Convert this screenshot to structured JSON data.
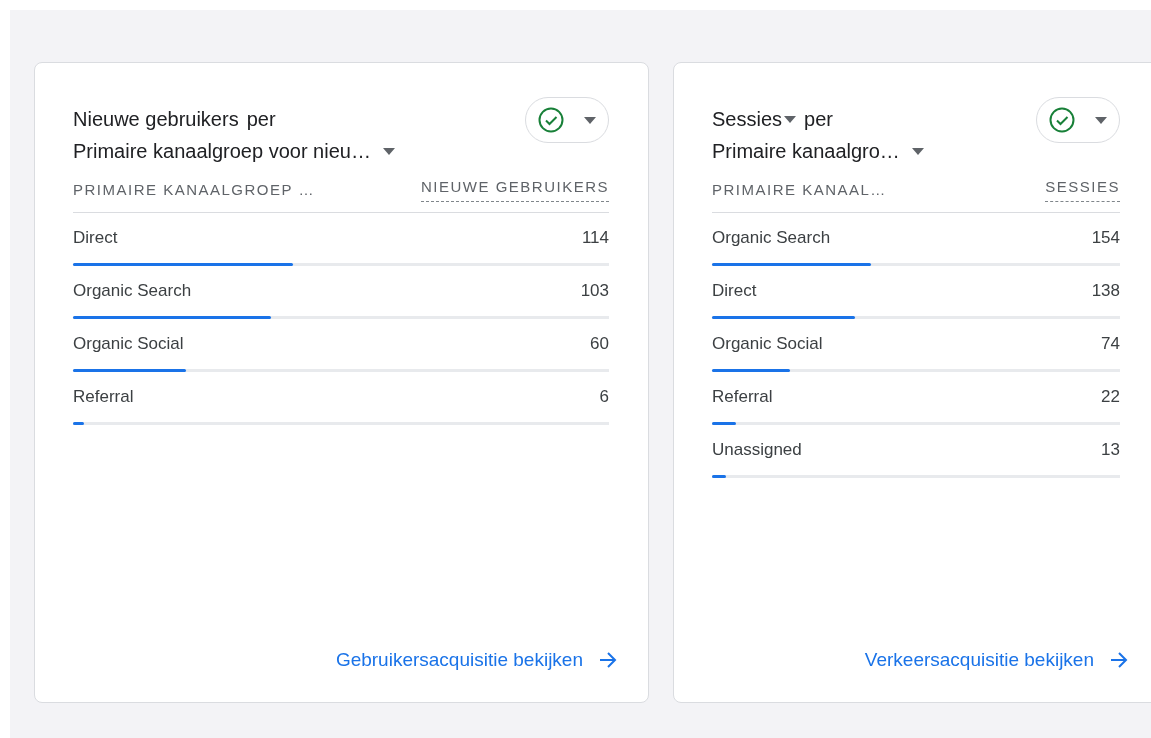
{
  "cards": [
    {
      "title_metric": "Nieuwe gebruikers",
      "metric_dropdown": false,
      "title_per": "per",
      "title_dimension": "Primaire kanaalgroep voor nieu…",
      "status_ok": true,
      "columns": [
        "PRIMAIRE KANAALGROEP …",
        "NIEUWE GEBRUIKERS"
      ],
      "rows": [
        {
          "label": "Direct",
          "value": "114",
          "level": 0.41
        },
        {
          "label": "Organic Search",
          "value": "103",
          "level": 0.37
        },
        {
          "label": "Organic Social",
          "value": "60",
          "level": 0.21
        },
        {
          "label": "Referral",
          "value": "6",
          "level": 0.02
        }
      ],
      "link": "Gebruikersacquisitie bekijken"
    },
    {
      "title_metric": "Sessies",
      "metric_dropdown": true,
      "title_per": "per",
      "title_dimension": "Primaire kanaalgro…",
      "status_ok": true,
      "columns": [
        "PRIMAIRE KANAAL…",
        "SESSIES"
      ],
      "rows": [
        {
          "label": "Organic Search",
          "value": "154",
          "level": 0.39
        },
        {
          "label": "Direct",
          "value": "138",
          "level": 0.35
        },
        {
          "label": "Organic Social",
          "value": "74",
          "level": 0.19
        },
        {
          "label": "Referral",
          "value": "22",
          "level": 0.06
        },
        {
          "label": "Unassigned",
          "value": "13",
          "level": 0.035
        }
      ],
      "link": "Verkeersacquisitie bekijken"
    }
  ]
}
